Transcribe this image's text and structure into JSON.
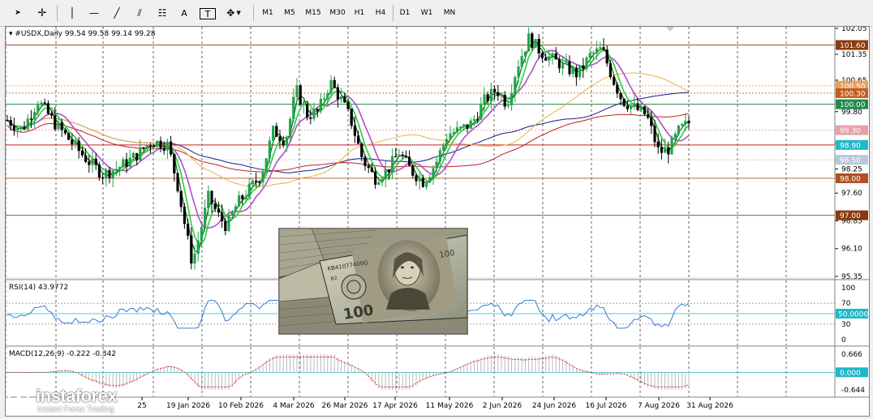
{
  "toolbar": {
    "tools": [
      {
        "name": "cursor-tool",
        "glyph": "➤"
      },
      {
        "name": "crosshair-tool",
        "glyph": "✛"
      },
      {
        "name": "vertical-line-tool",
        "glyph": "│"
      },
      {
        "name": "horizontal-line-tool",
        "glyph": "—"
      },
      {
        "name": "trendline-tool",
        "glyph": "╱"
      },
      {
        "name": "channel-tool",
        "glyph": "⫽"
      },
      {
        "name": "fibonacci-tool",
        "glyph": "☷"
      },
      {
        "name": "text-tool",
        "glyph": "A"
      },
      {
        "name": "text-label-tool",
        "glyph": "T"
      },
      {
        "name": "shapes-tool",
        "glyph": "✥"
      }
    ],
    "timeframes": [
      "M1",
      "M5",
      "M15",
      "M30",
      "H1",
      "H4",
      "D1",
      "W1",
      "MN"
    ]
  },
  "main_chart": {
    "header": "#USDX,Daily  99.54 99.58 99.14 99.28",
    "price_levels": [
      "102.05",
      "101.35",
      "100.65",
      "99.80",
      "98.95",
      "98.25",
      "97.60",
      "96.85",
      "96.10",
      "95.35"
    ],
    "price_tags": [
      {
        "label": "101.60",
        "color": "#8b3a0e"
      },
      {
        "label": "100.50",
        "color": "#e8a060"
      },
      {
        "label": "100.30",
        "color": "#c06020"
      },
      {
        "label": "100.00",
        "color": "#1e8a4a"
      },
      {
        "label": "99.30",
        "color": "#e8a0a8"
      },
      {
        "label": "98.90",
        "color": "#20b8c8"
      },
      {
        "label": "98.50",
        "color": "#b8c8d8"
      },
      {
        "label": "98.00",
        "color": "#b05020"
      },
      {
        "label": "97.00",
        "color": "#8b3a0e"
      }
    ]
  },
  "rsi_panel": {
    "header": "RSI(14) 43.9772",
    "levels": [
      "100",
      "70",
      "30",
      "0"
    ],
    "tag": "50.0000",
    "tag_color": "#20b8c8"
  },
  "macd_panel": {
    "header": "MACD(12,26,9) -0.222 -0.342",
    "levels": [
      "0.666",
      "-0.644"
    ],
    "tag": "0.000",
    "tag_color": "#20b8c8"
  },
  "time_axis": [
    "25",
    "19 Jan 2026",
    "10 Feb 2026",
    "4 Mar 2026",
    "26 Mar 2026",
    "17 Apr 2026",
    "11 May 2026",
    "2 Jun 2026",
    "24 Jun 2026",
    "16 Jul 2026",
    "7 Aug 2026",
    "31 Aug 2026"
  ],
  "watermark": {
    "brand": "instaforex",
    "tagline": "Instant Forex Trading"
  },
  "colors": {
    "bull": "#22a44a",
    "bear": "#000000",
    "ma_green_dark": "#0a6a1a",
    "ma_green": "#2ecc40",
    "ma_violet": "#b050c8",
    "ma_orange": "#f0b040",
    "ma_navy": "#1a1a8a",
    "ma_red": "#c02020",
    "rsi_line": "#1e6fd0",
    "level_cyan": "#20b8c8"
  }
}
